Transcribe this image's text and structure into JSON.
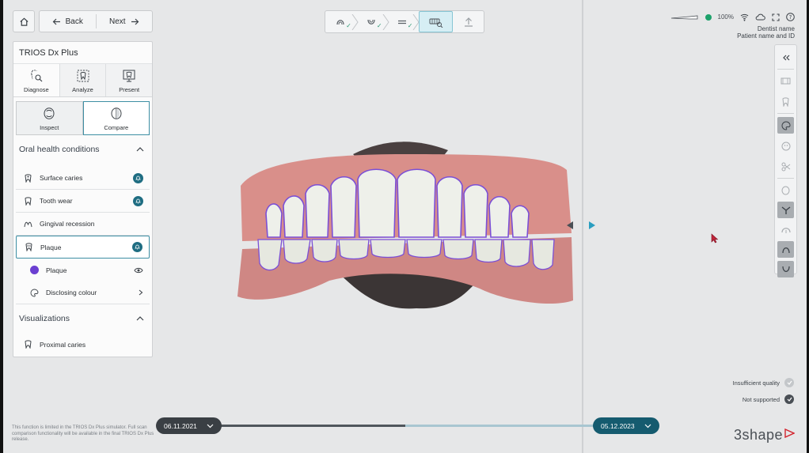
{
  "nav": {
    "back_label": "Back",
    "next_label": "Next"
  },
  "workflow": {
    "steps": [
      "scan-upper",
      "scan-lower",
      "bite",
      "analyze",
      "export"
    ],
    "active": "analyze"
  },
  "status": {
    "battery": "100%",
    "user_name": "Dentist name",
    "patient_label": "Patient name and ID"
  },
  "panel": {
    "title": "TRIOS Dx Plus",
    "mode_tabs": [
      "Diagnose",
      "Analyze",
      "Present"
    ],
    "sub_tabs": [
      "Inspect",
      "Compare"
    ],
    "section1": "Oral health conditions",
    "conditions": [
      "Surface caries",
      "Tooth wear",
      "Gingival recession",
      "Plaque"
    ],
    "plaque_sub": {
      "item": "Plaque",
      "disclosing": "Disclosing colour"
    },
    "section2": "Visualizations",
    "visualizations": [
      "Proximal caries"
    ]
  },
  "colors": {
    "accent": "#1f6d82",
    "plaque": "#6b3fd1",
    "selection": "#3e8fa4"
  },
  "timeline": {
    "date_left": "06.11.2021",
    "date_right": "05.12.2023"
  },
  "legend": {
    "insufficient": "Insufficient quality",
    "not_supported": "Not supported"
  },
  "note": "This function is limited in the TRIOS Dx Plus simulator. Full scan comparison functionality will be available in the final TRIOS Dx Plus release.",
  "brand": "3shape"
}
